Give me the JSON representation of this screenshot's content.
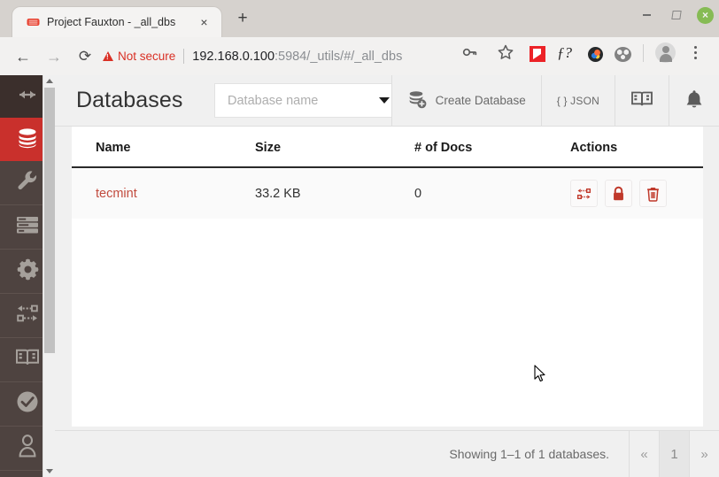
{
  "browser": {
    "tab": {
      "title": "Project Fauxton - _all_dbs",
      "favicon": "couchdb-icon",
      "close_label": "×"
    },
    "new_tab_label": "+",
    "window_controls": {
      "minimize": "minimize-icon",
      "maximize": "maximize-icon",
      "close": "×"
    },
    "nav": {
      "back": "←",
      "forward": "→",
      "reload": "⟳"
    },
    "omnibox": {
      "security_label": "Not secure",
      "url_host": "192.168.0.100",
      "url_path": ":5984/_utils/#/_all_dbs",
      "key_icon": "password-key-icon",
      "star_icon": "bookmark-star-icon"
    },
    "extensions": [
      {
        "name": "flipboard-extension-icon"
      },
      {
        "name": "f-question-extension-icon",
        "label": "ƒ?"
      },
      {
        "name": "color-circle-extension-icon"
      },
      {
        "name": "film-reel-extension-icon"
      }
    ],
    "profile_icon": "profile-avatar-icon",
    "menu_icon": "kebab-menu-icon"
  },
  "sidebar": {
    "items": [
      {
        "name": "toggle-sidebar",
        "icon": "arrows-horizontal-icon",
        "active": false,
        "top": true
      },
      {
        "name": "databases",
        "icon": "database-icon",
        "active": true
      },
      {
        "name": "setup",
        "icon": "wrench-icon",
        "active": false
      },
      {
        "name": "active-tasks",
        "icon": "tasks-list-icon",
        "active": false
      },
      {
        "name": "configuration",
        "icon": "gear-icon",
        "active": false
      },
      {
        "name": "replication",
        "icon": "replication-arrows-icon",
        "active": false
      },
      {
        "name": "documentation",
        "icon": "open-book-icon",
        "active": false
      },
      {
        "name": "verify",
        "icon": "check-circle-icon",
        "active": false
      },
      {
        "name": "user-account",
        "icon": "user-person-icon",
        "active": false
      }
    ],
    "scrollbar": {
      "up_arrow": "scroll-up-arrow",
      "down_arrow": "scroll-down-arrow"
    }
  },
  "header": {
    "title": "Databases",
    "search": {
      "placeholder": "Database name",
      "value": "",
      "caret": "dropdown-caret-icon"
    },
    "actions": [
      {
        "name": "create-database",
        "label": "Create Database",
        "icon": "database-plus-icon"
      },
      {
        "name": "json-view",
        "label": "{ } JSON",
        "icon": "json-icon"
      },
      {
        "name": "documentation",
        "label": "",
        "icon": "open-book-icon"
      },
      {
        "name": "notifications",
        "label": "",
        "icon": "bell-icon"
      }
    ]
  },
  "table": {
    "columns": [
      "Name",
      "Size",
      "# of Docs",
      "Actions"
    ],
    "rows": [
      {
        "name": "tecmint",
        "size": "33.2 KB",
        "docs": "0",
        "actions": [
          {
            "name": "replicate",
            "icon": "replication-arrows-icon"
          },
          {
            "name": "permissions",
            "icon": "lock-icon"
          },
          {
            "name": "delete",
            "icon": "trash-icon"
          }
        ]
      }
    ]
  },
  "footer": {
    "showing_text": "Showing 1–1 of 1 databases.",
    "pagination": {
      "prev": "«",
      "pages": [
        "1"
      ],
      "next": "»"
    }
  },
  "colors": {
    "sidebar_bg": "#4e4340",
    "sidebar_top_bg": "#3b2f2c",
    "active_red": "#c9302c",
    "link_red": "#c14b3e",
    "not_secure_red": "#d93025",
    "page_bg": "#f0f0f0"
  }
}
